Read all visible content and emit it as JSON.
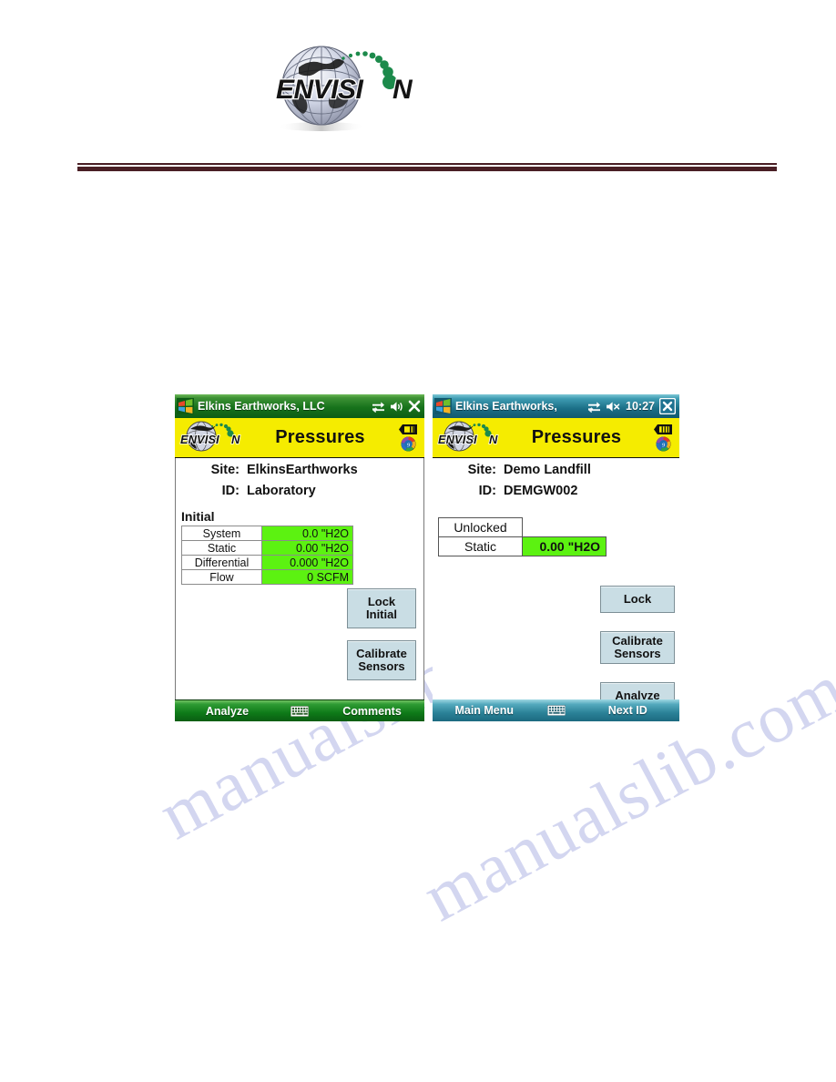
{
  "page": {
    "logo_wordmark": "ENVISION",
    "watermark_line1": "manualslib.com",
    "watermark_line2": "manualslib.com"
  },
  "screens": [
    {
      "id": "left",
      "titlebar": {
        "window_title": "Elkins Earthworks, LLC",
        "start_icon": "windows-start-icon",
        "connectivity_icon": "connectivity-icon",
        "volume_icon": "speaker-icon",
        "close_icon": "close-icon",
        "time": ""
      },
      "appbar": {
        "logo": "envision-logo",
        "title": "Pressures",
        "battery_icon": "battery-icon",
        "status_icon": "color-wheel-icon"
      },
      "info": [
        {
          "label": "Site:",
          "value": "ElkinsEarthworks"
        },
        {
          "label": "ID:",
          "value": "Laboratory"
        }
      ],
      "section_caption": "Initial",
      "readings": [
        {
          "name": "System",
          "value": "0.0 \"H2O"
        },
        {
          "name": "Static",
          "value": "0.00 \"H2O"
        },
        {
          "name": "Differential",
          "value": "0.000 \"H2O"
        },
        {
          "name": "Flow",
          "value": "0 SCFM"
        }
      ],
      "buttons": [
        {
          "id": "lock-initial",
          "line1": "Lock",
          "line2": "Initial"
        },
        {
          "id": "calibrate-sensors",
          "line1": "Calibrate",
          "line2": "Sensors"
        }
      ],
      "softkeys": {
        "left": "Analyze",
        "keyboard_icon": "keyboard-icon",
        "right": "Comments"
      }
    },
    {
      "id": "right",
      "titlebar": {
        "window_title": "Elkins Earthworks,",
        "start_icon": "windows-start-icon",
        "connectivity_icon": "connectivity-icon",
        "volume_icon": "speaker-muted-icon",
        "close_icon": "close-icon",
        "time": "10:27"
      },
      "appbar": {
        "logo": "envision-logo",
        "title": "Pressures",
        "battery_icon": "battery-icon",
        "status_icon": "color-wheel-icon"
      },
      "info": [
        {
          "label": "Site:",
          "value": "Demo Landfill"
        },
        {
          "label": "ID:",
          "value": "DEMGW002"
        }
      ],
      "lock_state": "Unlocked",
      "readings": [
        {
          "name": "Static",
          "value": "0.00 \"H2O"
        }
      ],
      "buttons": [
        {
          "id": "lock",
          "line1": "Lock",
          "line2": ""
        },
        {
          "id": "calibrate-sensors",
          "line1": "Calibrate",
          "line2": "Sensors"
        },
        {
          "id": "analyze",
          "line1": "Analyze",
          "line2": ""
        }
      ],
      "softkeys": {
        "left": "Main Menu",
        "keyboard_icon": "keyboard-icon",
        "right": "Next ID"
      }
    }
  ],
  "colors": {
    "value_green": "#5CF211",
    "appbar_yellow": "#F5EC00",
    "titlebar_green": "#17731B",
    "titlebar_teal": "#1B6F87",
    "button_blue": "#C9DDE4",
    "rule_maroon": "#4A1F25"
  }
}
